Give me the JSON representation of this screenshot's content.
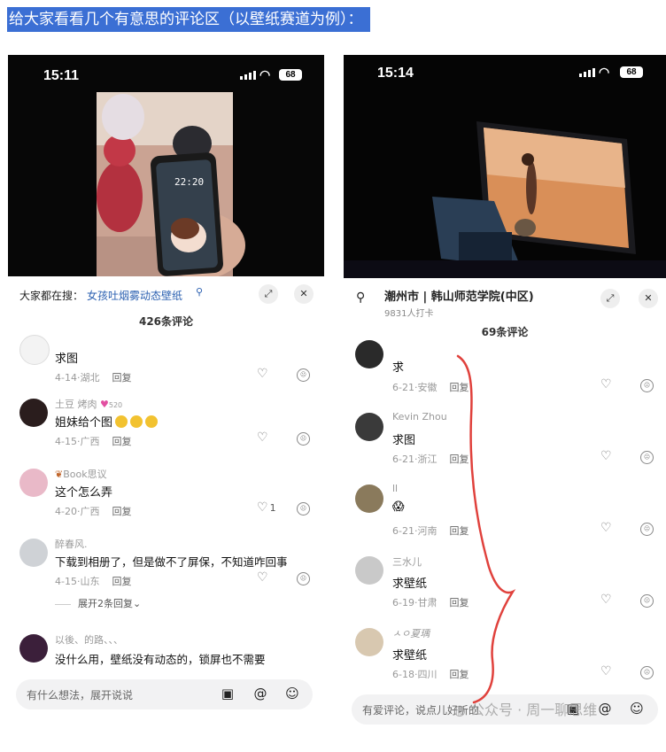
{
  "headline": "给大家看看几个有意思的评论区（以壁纸赛道为例）：",
  "left": {
    "status": {
      "time": "15:11",
      "battery": "68"
    },
    "video_lock_time": "22:20",
    "search": {
      "prefix": "大家都在搜：",
      "query": "女孩吐烟雾动态壁纸"
    },
    "comment_count": "426条评论",
    "comments": [
      {
        "user": "",
        "text": "求图",
        "date": "4-14",
        "region": "湖北",
        "reply": "回复",
        "likes": ""
      },
      {
        "user": "土豆 烤肉",
        "badge": "520",
        "text": "姐妹给个图",
        "date": "4-15",
        "region": "广西",
        "reply": "回复",
        "likes": ""
      },
      {
        "user": "Book思议",
        "text": "这个怎么弄",
        "date": "4-20",
        "region": "广西",
        "reply": "回复",
        "likes": "1"
      },
      {
        "user": "醉春风.",
        "text": "下载到相册了，但是做不了屏保，不知道咋回事",
        "date": "4-15",
        "region": "山东",
        "reply": "回复",
        "likes": ""
      },
      {
        "user": "以後、的路、、、",
        "text": "没什么用，壁纸没有动态的，锁屏也不需要",
        "date": "",
        "region": "",
        "reply": "",
        "likes": ""
      }
    ],
    "expand_replies": "展开2条回复",
    "input_placeholder": "有什么想法，展开说说"
  },
  "right": {
    "status": {
      "time": "15:14",
      "battery": "68"
    },
    "location": {
      "name": "潮州市 | 韩山师范学院(中区)",
      "sub": "9831人打卡"
    },
    "comment_count": "69条评论",
    "comments": [
      {
        "user": "",
        "text": "求",
        "date": "6-21",
        "region": "安徽",
        "reply": "回复"
      },
      {
        "user": "Kevin Zhou",
        "text": "求图",
        "date": "6-21",
        "region": "浙江",
        "reply": "回复"
      },
      {
        "user": "ll",
        "text": "😱",
        "date": "6-21",
        "region": "河南",
        "reply": "回复"
      },
      {
        "user": "三水儿",
        "text": "求壁纸",
        "date": "6-19",
        "region": "甘肃",
        "reply": "回复"
      },
      {
        "user": "ㅅㅇ夏瑀",
        "text": "求壁纸",
        "date": "6-18",
        "region": "四川",
        "reply": "回复"
      }
    ],
    "input_placeholder": "有爱评论，说点儿好听的",
    "watermark": "公众号 · 周一聊思维"
  },
  "colors": {
    "headline_bg": "#3b6fd4",
    "link": "#2a5fb0",
    "annotation": "#e0413c"
  }
}
